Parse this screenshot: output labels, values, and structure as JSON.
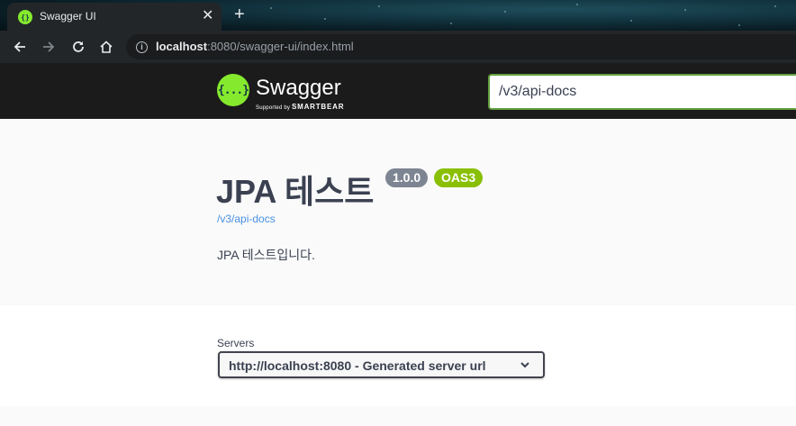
{
  "browser": {
    "tab_title": "Swagger UI",
    "tab_close": "✕",
    "new_tab": "+",
    "url_host": "localhost",
    "url_rest": ":8080/swagger-ui/index.html",
    "info": "i"
  },
  "topbar": {
    "logo_glyph": "{...}",
    "logo_text": "Swagger",
    "logo_sub_prefix": "Supported by ",
    "logo_sub_brand": "SMARTBEAR",
    "spec_url_value": "/v3/api-docs"
  },
  "info": {
    "title": "JPA 테스트",
    "version_badge": "1.0.0",
    "oas_badge": "OAS3",
    "spec_link": "/v3/api-docs",
    "description": "JPA 테스트입니다."
  },
  "servers": {
    "label": "Servers",
    "selected": "http://localhost:8080 - Generated server url"
  },
  "colors": {
    "swagger_green": "#85ea2d",
    "topbar_bg": "#1b1b1b",
    "version_badge": "#7d8492",
    "oas_badge": "#89bf04",
    "link": "#4990e2",
    "text": "#3b4151"
  }
}
